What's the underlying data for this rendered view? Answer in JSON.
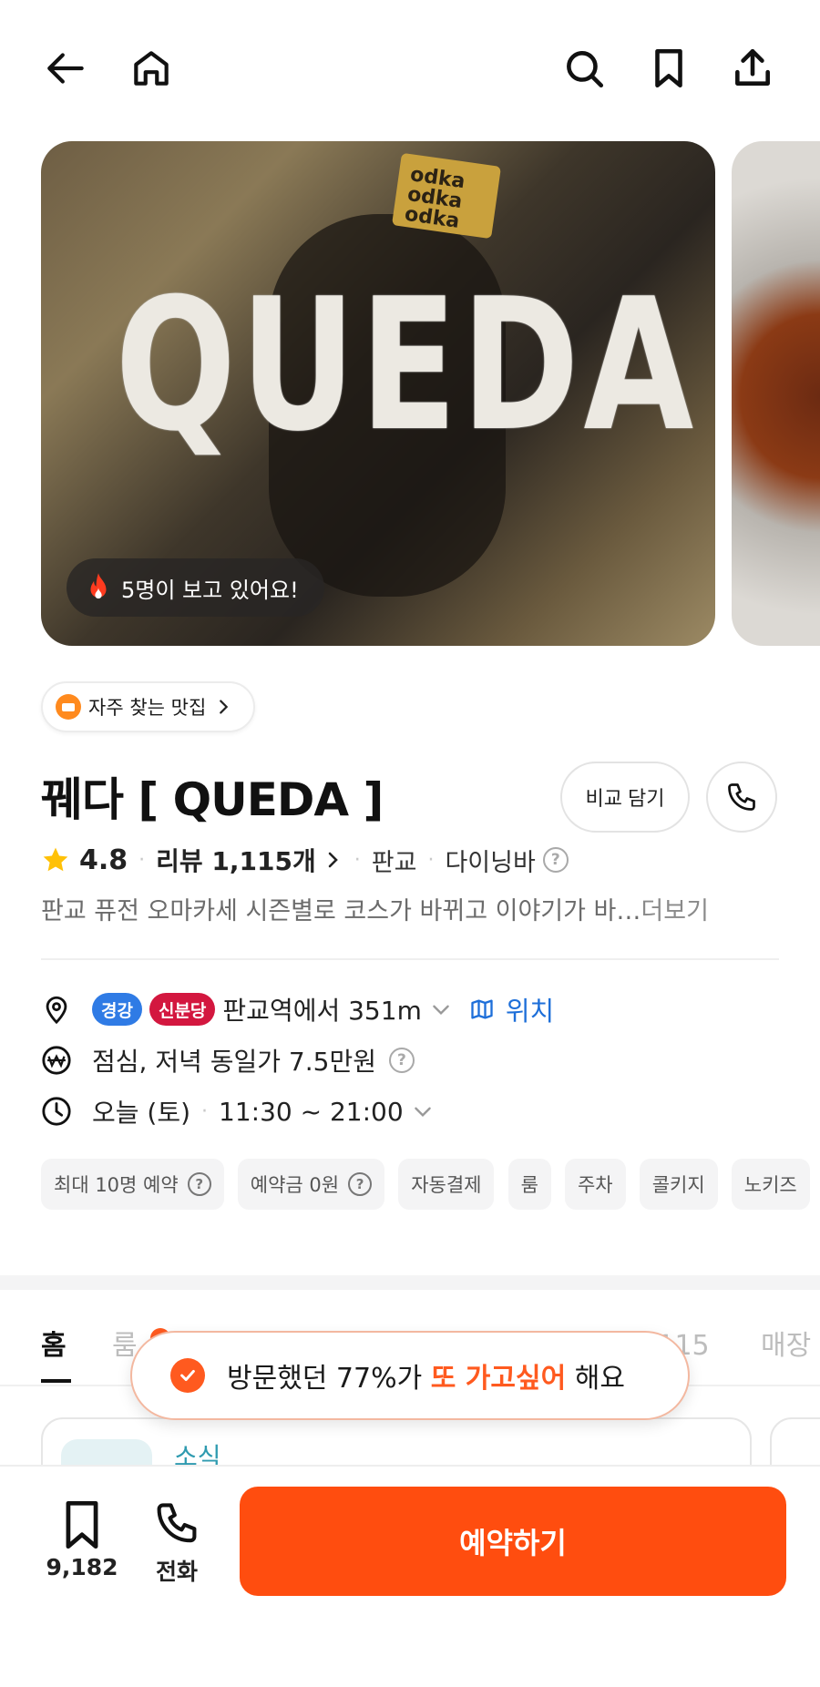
{
  "topbar": {
    "back_icon": "arrow-left-icon",
    "home_icon": "home-icon",
    "search_icon": "search-icon",
    "bookmark_icon": "bookmark-icon",
    "share_icon": "share-icon"
  },
  "gallery": {
    "image_text": "QUEDA",
    "image_sign_text": "odka\nodka\nodka",
    "watching_text": "5명이 보고 있어요!"
  },
  "favorite_chip": {
    "label": "자주 찾는 맛집"
  },
  "restaurant": {
    "name": "꿰다 [ QUEDA ]",
    "compare_label": "비교 담기",
    "rating": "4.8",
    "review_label": "리뷰 1,115개",
    "area": "판교",
    "category": "다이닝바",
    "description": "판교 퓨전 오마카세 시즌별로 코스가 바뀌고 이야기가 바…",
    "more_label": "더보기"
  },
  "info": {
    "badge_1": "경강",
    "badge_2": "신분당",
    "distance": "판교역에서 351m",
    "location_link": "위치",
    "price": "점심, 저녁 동일가 7.5만원",
    "hours_day": "오늘 (토)",
    "hours_time": "11:30 ~ 21:00"
  },
  "tags": [
    "최대 10명 예약",
    "예약금 0원",
    "자동결제",
    "룸",
    "주차",
    "콜키지",
    "노키즈"
  ],
  "tabs": {
    "home": "홈",
    "room": "룸",
    "review": "리뷰 1,115",
    "store": "매장"
  },
  "card": {
    "label": "소식"
  },
  "toast": {
    "prefix": "방문했던 77%가 ",
    "highlight": "또 가고싶어",
    "suffix": " 해요"
  },
  "bottom": {
    "bookmark_count": "9,182",
    "call_label": "전화",
    "reserve_label": "예약하기"
  },
  "colors": {
    "accent": "#ff4d0f",
    "link": "#1e6fd9",
    "badge_gyeonggang": "#2f7be5",
    "badge_sinbundang": "#d3173f"
  }
}
